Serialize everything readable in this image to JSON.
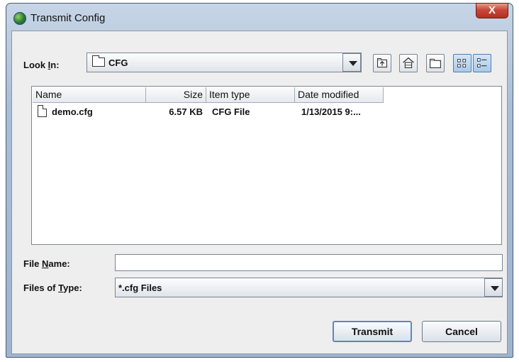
{
  "window": {
    "title": "Transmit Config",
    "close_label": "X"
  },
  "look_in": {
    "label_pre": "Look ",
    "label_mnemonic": "I",
    "label_post": "n:",
    "value": "CFG"
  },
  "toolbar": {
    "buttons": [
      "up-one-level-icon",
      "home-icon",
      "new-folder-icon",
      "list-view-icon",
      "details-view-icon"
    ]
  },
  "file_list": {
    "columns": [
      "Name",
      "Size",
      "Item type",
      "Date modified"
    ],
    "rows": [
      {
        "name": "demo.cfg",
        "size": "6.57 KB",
        "type": "CFG File",
        "date": "1/13/2015 9:..."
      }
    ]
  },
  "file_name": {
    "label_pre": "File ",
    "label_mnemonic": "N",
    "label_post": "ame:",
    "value": ""
  },
  "files_of_type": {
    "label_pre": "Files of ",
    "label_mnemonic": "T",
    "label_post": "ype:",
    "value": "*.cfg Files"
  },
  "buttons": {
    "transmit": "Transmit",
    "cancel": "Cancel"
  },
  "colors": {
    "title_bar": "#a9bdd6",
    "close_button": "#c9463a",
    "focus_border": "#5f87b9"
  }
}
